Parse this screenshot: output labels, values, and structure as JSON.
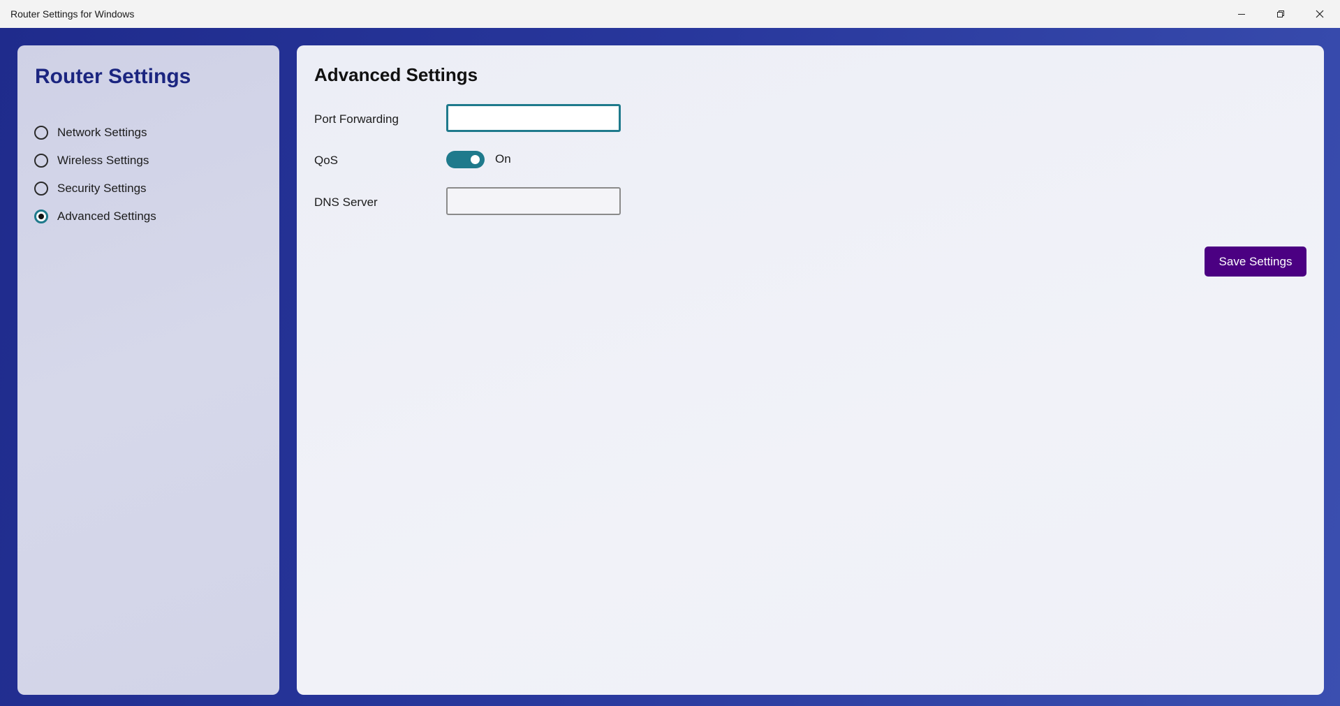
{
  "window": {
    "title": "Router Settings for Windows",
    "controls": [
      "minimize",
      "restore",
      "close"
    ]
  },
  "sidebar": {
    "title": "Router Settings",
    "items": [
      {
        "label": "Network Settings",
        "selected": false
      },
      {
        "label": "Wireless Settings",
        "selected": false
      },
      {
        "label": "Security Settings",
        "selected": false
      },
      {
        "label": "Advanced Settings",
        "selected": true
      }
    ]
  },
  "main": {
    "title": "Advanced Settings",
    "port_forwarding": {
      "label": "Port Forwarding",
      "value": "",
      "placeholder": ""
    },
    "qos": {
      "label": "QoS",
      "state_text": "On",
      "on": true
    },
    "dns_server": {
      "label": "DNS Server",
      "value": "",
      "placeholder": ""
    },
    "save_label": "Save Settings"
  },
  "colors": {
    "accent": "#1f7a8c",
    "save_button": "#4b0082",
    "sidebar_title": "#1b2580",
    "background": "#28379c"
  },
  "icons": {
    "minimize": "minimize-icon",
    "restore": "restore-icon",
    "close": "close-icon"
  }
}
